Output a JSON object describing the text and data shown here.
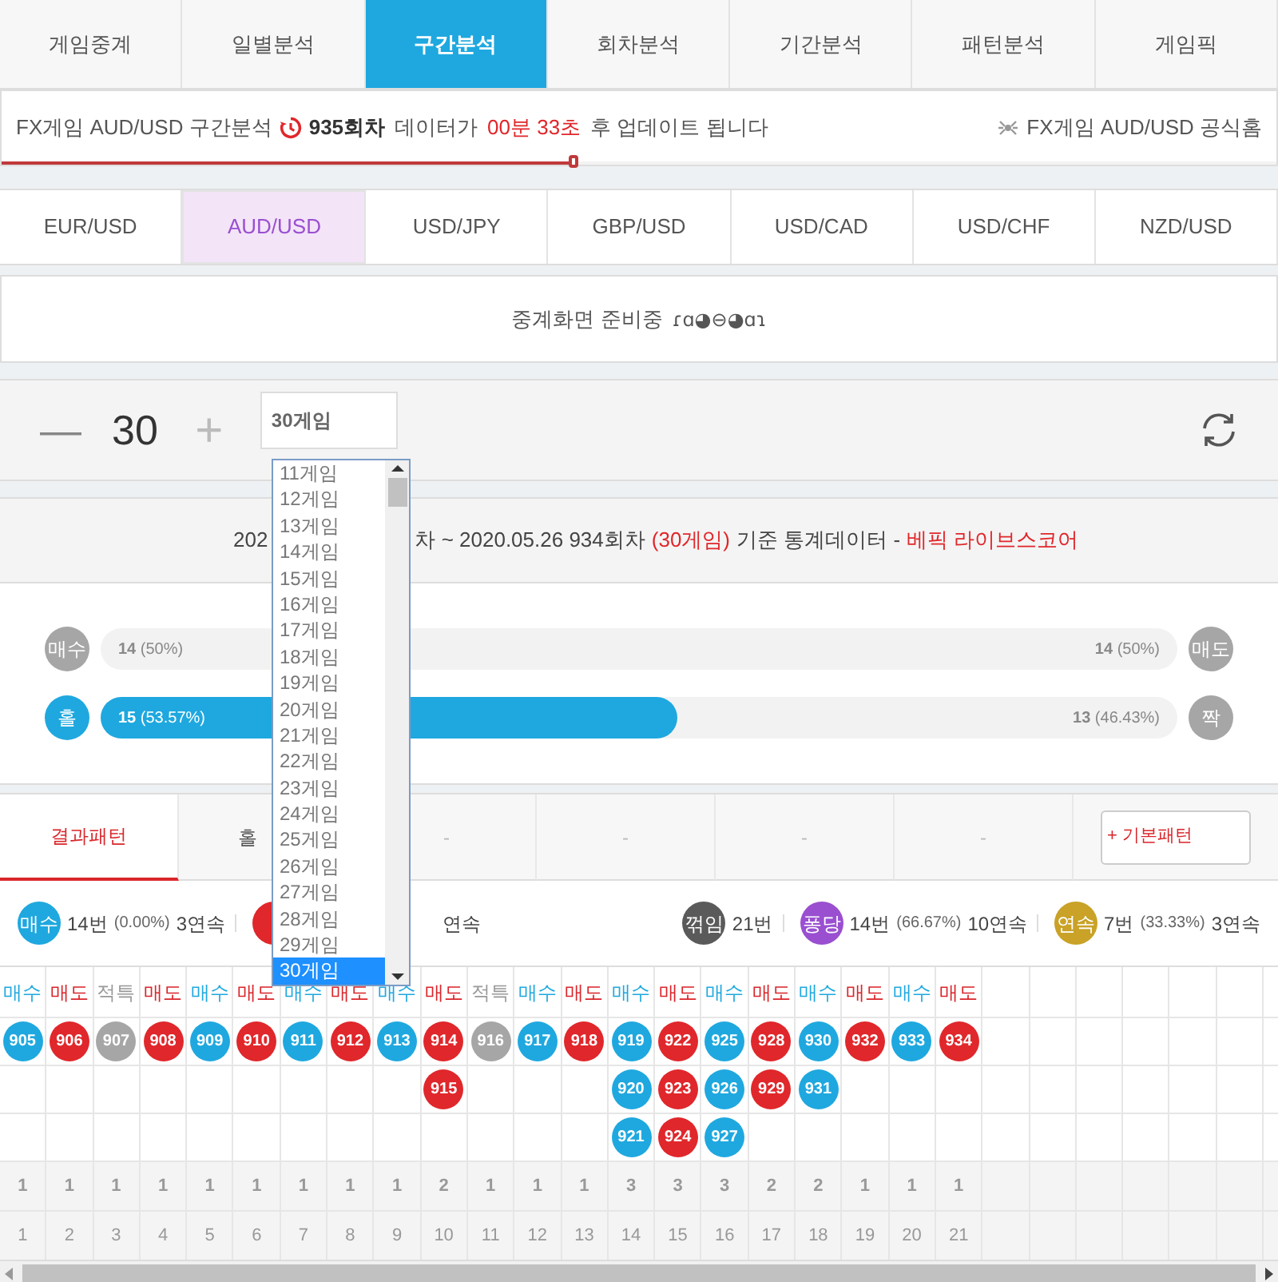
{
  "tabs": [
    {
      "label": "게임중계",
      "selected": false
    },
    {
      "label": "일별분석",
      "selected": false
    },
    {
      "label": "구간분석",
      "selected": true
    },
    {
      "label": "회차분석",
      "selected": false
    },
    {
      "label": "기간분석",
      "selected": false
    },
    {
      "label": "패턴분석",
      "selected": false
    },
    {
      "label": "게임픽",
      "selected": false
    }
  ],
  "info": {
    "prefix": "FX게임 AUD/USD 구간분석",
    "round": "935회차",
    "mid": "데이터가",
    "time": "00분 33초",
    "suffix": "후 업데이트 됩니다",
    "link": "FX게임 AUD/USD 공식홈",
    "level": 0.45
  },
  "pairs": [
    {
      "label": "EUR/USD",
      "selected": false
    },
    {
      "label": "AUD/USD",
      "selected": true
    },
    {
      "label": "USD/JPY",
      "selected": false
    },
    {
      "label": "GBP/USD",
      "selected": false
    },
    {
      "label": "USD/CAD",
      "selected": false
    },
    {
      "label": "USD/CHF",
      "selected": false
    },
    {
      "label": "NZD/USD",
      "selected": false
    }
  ],
  "broadcast": {
    "text": "중계화면 준비중",
    "emoticon": "ɾɑ◕⊖◕ɑɿ"
  },
  "counter": {
    "minus": "—",
    "value": "30",
    "plus": "+",
    "select_value": "30게임"
  },
  "dropdown": {
    "options": [
      {
        "label": "11게임",
        "selected": false
      },
      {
        "label": "12게임",
        "selected": false
      },
      {
        "label": "13게임",
        "selected": false
      },
      {
        "label": "14게임",
        "selected": false
      },
      {
        "label": "15게임",
        "selected": false
      },
      {
        "label": "16게임",
        "selected": false
      },
      {
        "label": "17게임",
        "selected": false
      },
      {
        "label": "18게임",
        "selected": false
      },
      {
        "label": "19게임",
        "selected": false
      },
      {
        "label": "20게임",
        "selected": false
      },
      {
        "label": "21게임",
        "selected": false
      },
      {
        "label": "22게임",
        "selected": false
      },
      {
        "label": "23게임",
        "selected": false
      },
      {
        "label": "24게임",
        "selected": false
      },
      {
        "label": "25게임",
        "selected": false
      },
      {
        "label": "26게임",
        "selected": false
      },
      {
        "label": "27게임",
        "selected": false
      },
      {
        "label": "28게임",
        "selected": false
      },
      {
        "label": "29게임",
        "selected": false
      },
      {
        "label": "30게임",
        "selected": true
      }
    ]
  },
  "stats_header": {
    "part_1": "202",
    "part_2": "차 ~ 2020.05.26 934회차",
    "highlight": "(30게임)",
    "part_3": "기준 통계데이터 -",
    "brand": "베픽 라이브스코어"
  },
  "bars": [
    {
      "left_badge": {
        "label": "매수",
        "color": "#a6a6a6"
      },
      "left_text": "14",
      "left_pct": "(50%)",
      "right_text": "14",
      "right_pct": "(50%)",
      "right_badge": {
        "label": "매도",
        "color": "#a6a6a6"
      },
      "level": 0
    },
    {
      "left_badge": {
        "label": "홀",
        "color": "#1fa8df"
      },
      "left_text": "15",
      "left_pct": "(53.57%)",
      "right_text": "13",
      "right_pct": "(46.43%)",
      "right_badge": {
        "label": "짝",
        "color": "#a6a6a6"
      },
      "level": 0.5357
    }
  ],
  "pattern_tabs": [
    {
      "label": "결과패턴",
      "selected": true
    },
    {
      "label": "홀",
      "selected": false
    },
    {
      "label": "-",
      "selected": false
    },
    {
      "label": "-",
      "selected": false
    },
    {
      "label": "-",
      "selected": false
    },
    {
      "label": "-",
      "selected": false
    }
  ],
  "pattern_button": "+ 기본패턴",
  "legend": {
    "left": [
      {
        "badge": "매수",
        "color": "#1fa8df",
        "count": "14번",
        "pct": "(0.00%)",
        "streak": "3연속"
      },
      {
        "color": "#e0272b",
        "streak": "연속"
      }
    ],
    "right": [
      {
        "badge": "꺾임",
        "color": "#5a5a5a",
        "count": "21번"
      },
      {
        "badge": "퐁당",
        "color": "#9a4fd0",
        "count": "14번",
        "pct": "(66.67%)",
        "streak": "10연속"
      },
      {
        "badge": "연속",
        "color": "#c9a227",
        "count": "7번",
        "pct": "(33.33%)",
        "streak": "3연속"
      }
    ]
  },
  "grid": {
    "columns": [
      {
        "kind": "buy",
        "header": "매수",
        "balls": [
          "905"
        ],
        "count": "1",
        "index": "1"
      },
      {
        "kind": "sell",
        "header": "매도",
        "balls": [
          "906"
        ],
        "count": "1",
        "index": "2"
      },
      {
        "kind": "tie",
        "header": "적특",
        "balls": [
          "907"
        ],
        "count": "1",
        "index": "3"
      },
      {
        "kind": "sell",
        "header": "매도",
        "balls": [
          "908"
        ],
        "count": "1",
        "index": "4"
      },
      {
        "kind": "buy",
        "header": "매수",
        "balls": [
          "909"
        ],
        "count": "1",
        "index": "5"
      },
      {
        "kind": "sell",
        "header": "매도",
        "balls": [
          "910"
        ],
        "count": "1",
        "index": "6"
      },
      {
        "kind": "buy",
        "header": "매수",
        "balls": [
          "911"
        ],
        "count": "1",
        "index": "7"
      },
      {
        "kind": "sell",
        "header": "매도",
        "balls": [
          "912"
        ],
        "count": "1",
        "index": "8"
      },
      {
        "kind": "buy",
        "header": "매수",
        "balls": [
          "913"
        ],
        "count": "1",
        "index": "9"
      },
      {
        "kind": "sell",
        "header": "매도",
        "balls": [
          "914",
          "915"
        ],
        "count": "2",
        "index": "10"
      },
      {
        "kind": "tie",
        "header": "적특",
        "balls": [
          "916"
        ],
        "count": "1",
        "index": "11"
      },
      {
        "kind": "buy",
        "header": "매수",
        "balls": [
          "917"
        ],
        "count": "1",
        "index": "12"
      },
      {
        "kind": "sell",
        "header": "매도",
        "balls": [
          "918"
        ],
        "count": "1",
        "index": "13"
      },
      {
        "kind": "buy",
        "header": "매수",
        "balls": [
          "919",
          "920",
          "921"
        ],
        "count": "3",
        "index": "14"
      },
      {
        "kind": "sell",
        "header": "매도",
        "balls": [
          "922",
          "923",
          "924"
        ],
        "count": "3",
        "index": "15"
      },
      {
        "kind": "buy",
        "header": "매수",
        "balls": [
          "925",
          "926",
          "927"
        ],
        "count": "3",
        "index": "16"
      },
      {
        "kind": "sell",
        "header": "매도",
        "balls": [
          "928",
          "929"
        ],
        "count": "2",
        "index": "17"
      },
      {
        "kind": "buy",
        "header": "매수",
        "balls": [
          "930",
          "931"
        ],
        "count": "2",
        "index": "18"
      },
      {
        "kind": "sell",
        "header": "매도",
        "balls": [
          "932"
        ],
        "count": "1",
        "index": "19"
      },
      {
        "kind": "buy",
        "header": "매수",
        "balls": [
          "933"
        ],
        "count": "1",
        "index": "20"
      },
      {
        "kind": "sell",
        "header": "매도",
        "balls": [
          "934"
        ],
        "count": "1",
        "index": "21"
      }
    ]
  }
}
